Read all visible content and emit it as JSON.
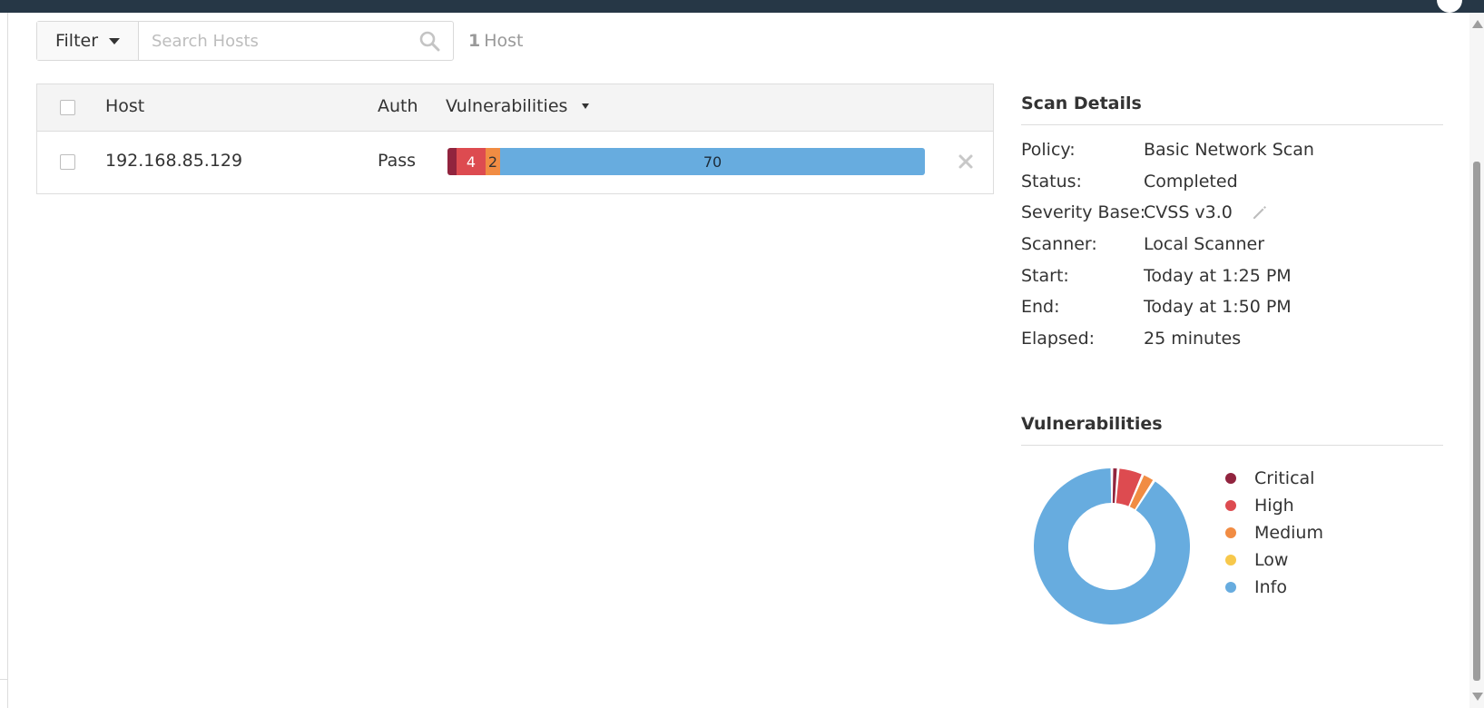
{
  "filter": {
    "button_label": "Filter",
    "search_placeholder": "Search Hosts",
    "host_count_number": "1",
    "host_count_label": "Host"
  },
  "table": {
    "columns": {
      "host": "Host",
      "auth": "Auth",
      "vulnerabilities": "Vulnerabilities"
    },
    "rows": [
      {
        "host": "192.168.85.129",
        "auth": "Pass",
        "counts": {
          "critical": "",
          "high": "4",
          "medium": "2",
          "info": "70"
        }
      }
    ]
  },
  "scan_details": {
    "title": "Scan Details",
    "fields": [
      {
        "label": "Policy:",
        "value": "Basic Network Scan"
      },
      {
        "label": "Status:",
        "value": "Completed"
      },
      {
        "label": "Severity Base:",
        "value": "CVSS v3.0"
      },
      {
        "label": "Scanner:",
        "value": "Local Scanner"
      },
      {
        "label": "Start:",
        "value": "Today at 1:25 PM"
      },
      {
        "label": "End:",
        "value": "Today at 1:50 PM"
      },
      {
        "label": "Elapsed:",
        "value": "25 minutes"
      }
    ]
  },
  "vulnerabilities": {
    "title": "Vulnerabilities",
    "legend": [
      {
        "label": "Critical",
        "color": "#91243e"
      },
      {
        "label": "High",
        "color": "#dd4b50"
      },
      {
        "label": "Medium",
        "color": "#f18c43"
      },
      {
        "label": "Low",
        "color": "#f7c84b"
      },
      {
        "label": "Info",
        "color": "#67acdf"
      }
    ]
  },
  "chart_data": {
    "type": "pie",
    "categories": [
      "Critical",
      "High",
      "Medium",
      "Low",
      "Info"
    ],
    "values": [
      1,
      4,
      2,
      0,
      70
    ],
    "colors": [
      "#91243e",
      "#dd4b50",
      "#f18c43",
      "#f7c84b",
      "#67acdf"
    ],
    "title": "Vulnerabilities"
  },
  "icons": {
    "search": "search-icon",
    "remove": "close-icon",
    "edit": "pencil-icon"
  }
}
